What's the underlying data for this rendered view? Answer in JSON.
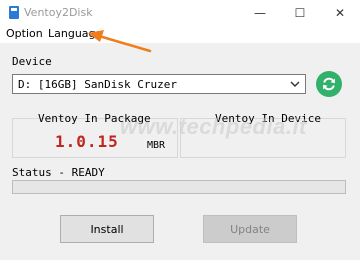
{
  "window": {
    "title": "Ventoy2Disk",
    "minimize_glyph": "—",
    "maximize_glyph": "☐",
    "close_glyph": "✕"
  },
  "menu": {
    "items": [
      {
        "label": "Option"
      },
      {
        "label": "Language"
      }
    ]
  },
  "device": {
    "label": "Device",
    "selected": "D: [16GB] SanDisk Cruzer",
    "refresh_icon": "refresh-icon"
  },
  "package": {
    "label": "Ventoy In Package",
    "version": "1.0.15",
    "partition_style": "MBR"
  },
  "installed": {
    "label": "Ventoy In Device",
    "version": ""
  },
  "watermark": "www.techpedia.it",
  "status": {
    "label": "Status - READY",
    "progress": 0
  },
  "buttons": {
    "install": "Install",
    "update": "Update"
  },
  "colors": {
    "refresh": "#31b16b",
    "version": "#c0261f",
    "arrow": "#f07d1c"
  }
}
